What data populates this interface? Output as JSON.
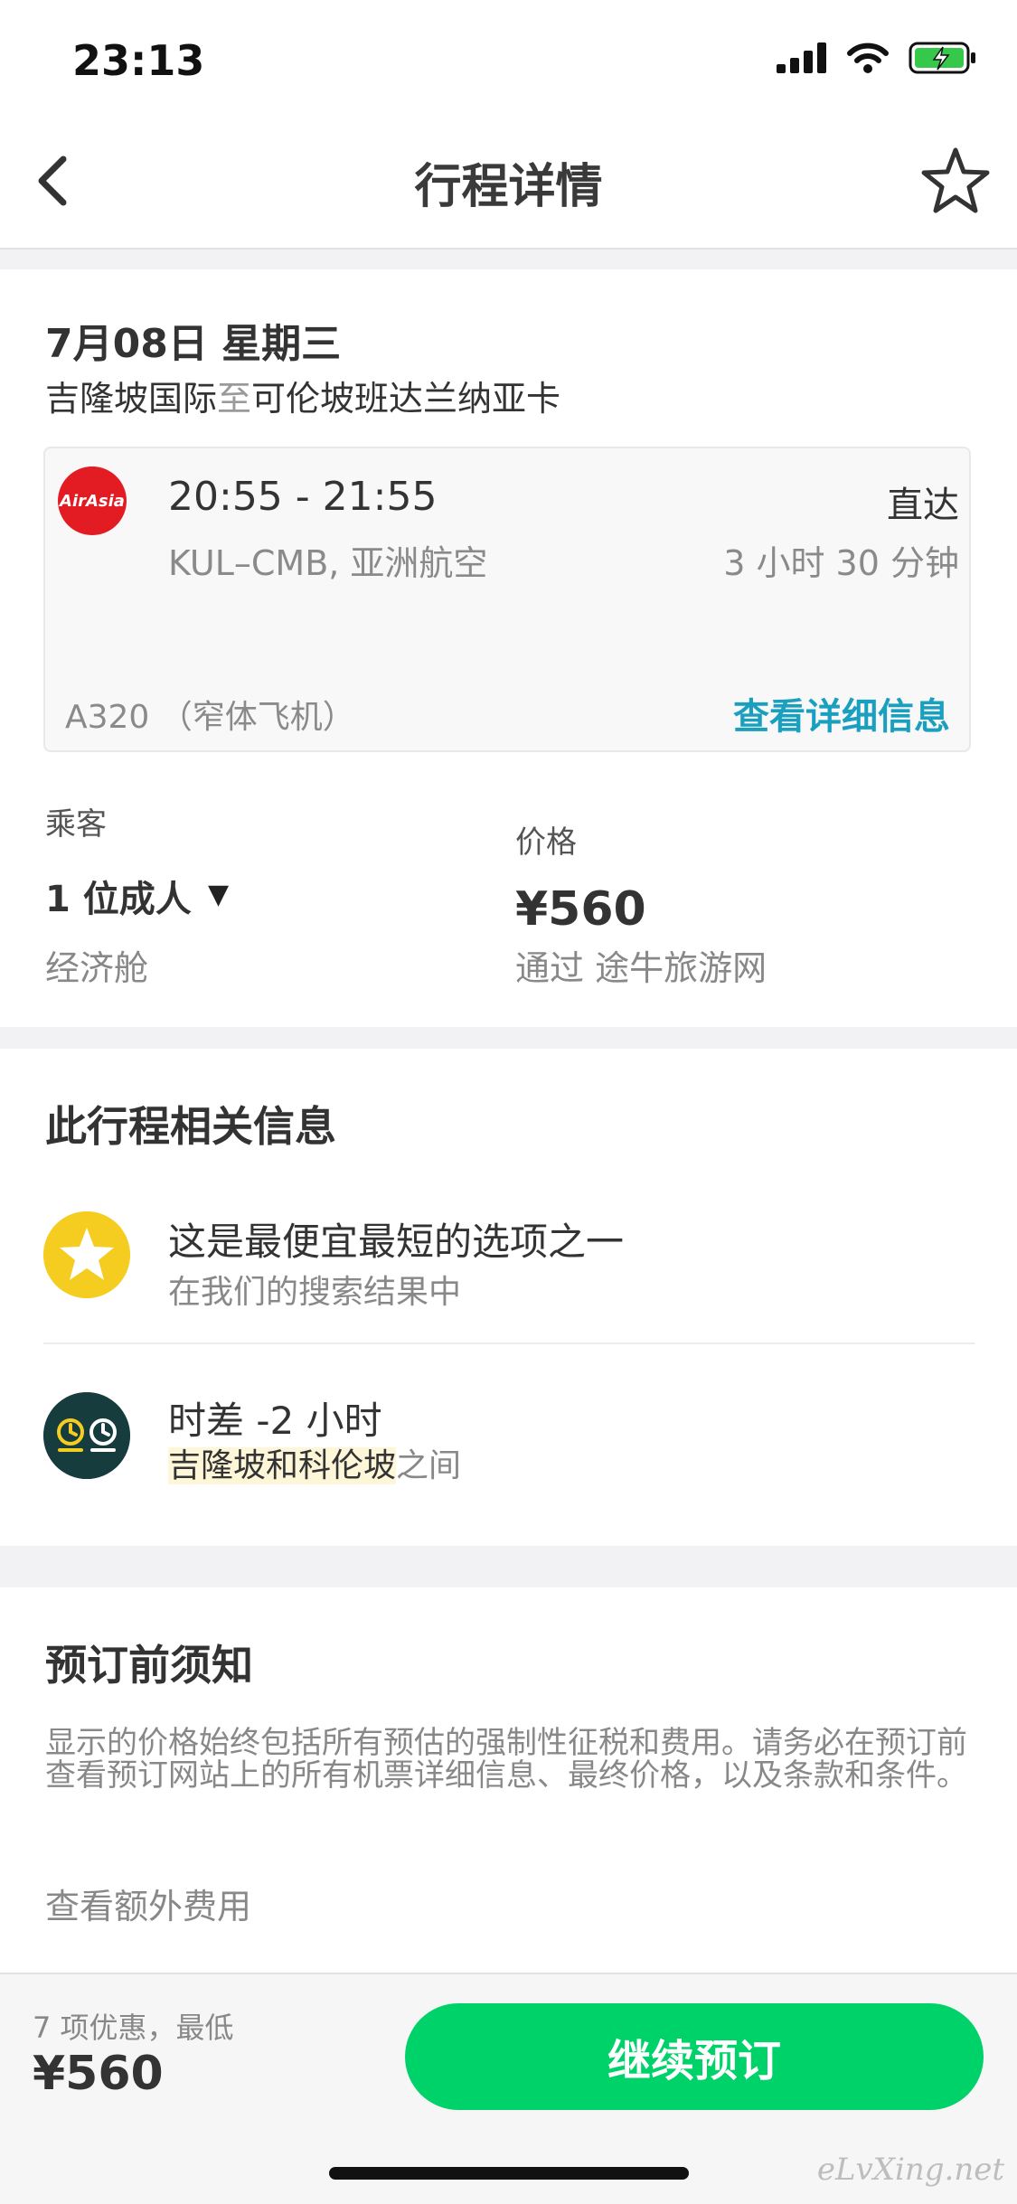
{
  "status_bar": {
    "time": "23:13"
  },
  "nav": {
    "title": "行程详情"
  },
  "trip": {
    "date": "7月08日 星期三",
    "origin": "吉隆坡国际",
    "to_word": "至",
    "destination": "可伦坡班达兰纳亚卡"
  },
  "flight": {
    "airline_logo_text": "AirAsia",
    "times": "20:55 - 21:55",
    "stops": "直达",
    "codes_airline": "KUL–CMB, 亚洲航空",
    "duration": "3 小时 30 分钟",
    "aircraft": "A320 （窄体飞机）",
    "details_link": "查看详细信息"
  },
  "booking": {
    "passenger_label": "乘客",
    "passenger_value": "1 位成人",
    "passenger_caret": "▼",
    "cabin": "经济舱",
    "price_label": "价格",
    "price": "¥560",
    "via": "通过 途牛旅游网"
  },
  "info": {
    "title": "此行程相关信息",
    "cheapest_main": "这是最便宜最短的选项之一",
    "cheapest_sub": "在我们的搜索结果中",
    "tz_main": "时差 -2 小时",
    "tz_city1": "吉隆坡",
    "tz_and": "和",
    "tz_city2": "科伦坡",
    "tz_between": "之间"
  },
  "notice": {
    "title": "预订前须知",
    "body": "显示的价格始终包括所有预估的强制性征税和费用。请务必在预订前查看预订网站上的所有机票详细信息、最终价格，以及条款和条件。",
    "extra_fees": "查看额外费用"
  },
  "bottom": {
    "deals": "7 项优惠，最低",
    "price": "¥560",
    "continue_label": "继续预订"
  },
  "watermark": "eLvXing.net",
  "colors": {
    "accent_green": "#00d26a",
    "link_blue": "#1a9fbf",
    "airline_red": "#e31b23",
    "star_yellow": "#f5cd21",
    "clock_teal": "#163c3e"
  }
}
